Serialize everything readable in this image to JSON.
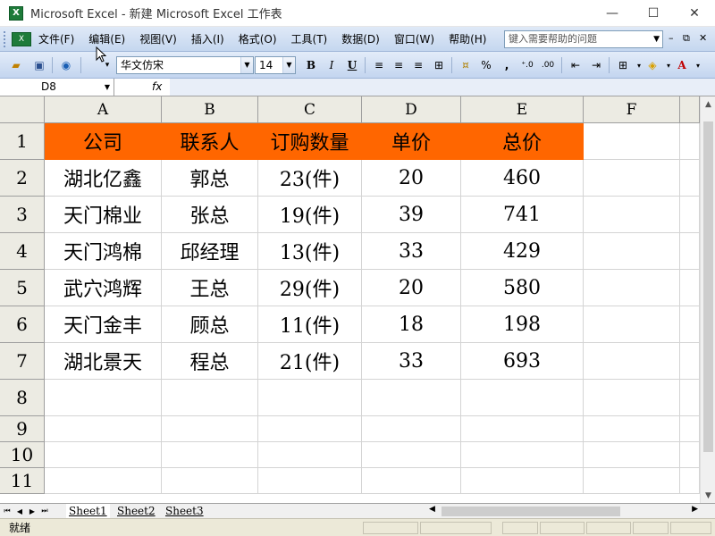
{
  "window": {
    "title": "Microsoft Excel - 新建 Microsoft Excel 工作表",
    "minimize_glyph": "—",
    "maximize_glyph": "☐",
    "close_glyph": "✕"
  },
  "menu": {
    "items": [
      {
        "label": "文件(F)"
      },
      {
        "label": "编辑(E)"
      },
      {
        "label": "视图(V)"
      },
      {
        "label": "插入(I)"
      },
      {
        "label": "格式(O)"
      },
      {
        "label": "工具(T)"
      },
      {
        "label": "数据(D)"
      },
      {
        "label": "窗口(W)"
      },
      {
        "label": "帮助(H)"
      }
    ],
    "help_placeholder": "键入需要帮助的问题"
  },
  "toolbar": {
    "font_name": "华文仿宋",
    "font_size": "14",
    "bold": "B",
    "italic": "I",
    "underline": "U",
    "percent": "%",
    "comma": ",",
    "inc_decimal": "⁺.0",
    "dec_decimal": ".00"
  },
  "formula_bar": {
    "name_box": "D8",
    "fx": "fx",
    "formula": ""
  },
  "sheet": {
    "columns": [
      "A",
      "B",
      "C",
      "D",
      "E",
      "F"
    ],
    "row_numbers": [
      "1",
      "2",
      "3",
      "4",
      "5",
      "6",
      "7",
      "8",
      "9",
      "10",
      "11"
    ],
    "header_row": [
      "公司",
      "联系人",
      "订购数量",
      "单价",
      "总价"
    ],
    "rows": [
      [
        "湖北亿鑫",
        "郭总",
        "23(件)",
        "20",
        "460"
      ],
      [
        "天门棉业",
        "张总",
        "19(件)",
        "39",
        "741"
      ],
      [
        "天门鸿棉",
        "邱经理",
        "13(件)",
        "33",
        "429"
      ],
      [
        "武穴鸿辉",
        "王总",
        "29(件)",
        "20",
        "580"
      ],
      [
        "天门金丰",
        "顾总",
        "11(件)",
        "18",
        "198"
      ],
      [
        "湖北景天",
        "程总",
        "21(件)",
        "33",
        "693"
      ]
    ],
    "header_fill_color": "#ff6600"
  },
  "tabs": {
    "sheets": [
      "Sheet1",
      "Sheet2",
      "Sheet3"
    ],
    "active": "Sheet1"
  },
  "status": {
    "text": "就绪"
  }
}
